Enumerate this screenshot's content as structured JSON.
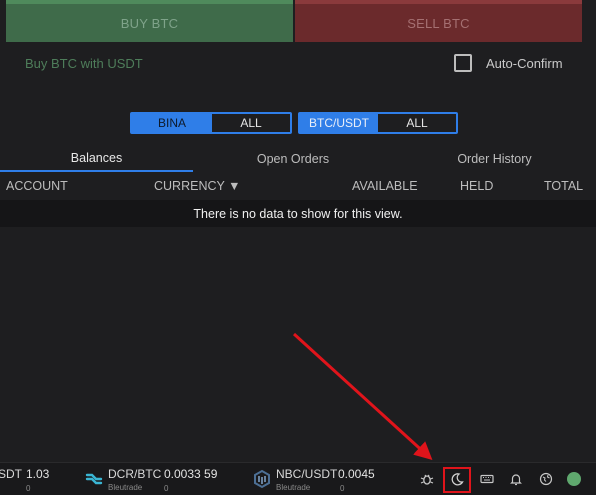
{
  "trade": {
    "buy_label": "BUY BTC",
    "sell_label": "SELL BTC",
    "buy_with": "Buy BTC with USDT",
    "auto_confirm": "Auto-Confirm"
  },
  "filters": {
    "exchange": [
      "BINA",
      "ALL"
    ],
    "market": [
      "BTC/USDT",
      "ALL"
    ]
  },
  "tabs": [
    "Balances",
    "Open Orders",
    "Order History"
  ],
  "table": {
    "columns": [
      "ACCOUNT",
      "CURRENCY ▼",
      "AVAILABLE",
      "HELD",
      "TOTAL"
    ],
    "empty_message": "There is no data to show for this view."
  },
  "tickers": [
    {
      "pair": "SDT",
      "price": "1.03",
      "exchange": "",
      "change": "0"
    },
    {
      "pair": "DCR/BTC",
      "price": "0.0033 59",
      "exchange": "Bleutrade",
      "change": "0"
    },
    {
      "pair": "NBC/USDT",
      "price": "0.0045",
      "exchange": "Bleutrade",
      "change": "0"
    }
  ],
  "colors": {
    "accent": "#2f7ee8",
    "buy": "#3f6b4a",
    "sell": "#6b2a2c",
    "annotation": "#e0141b",
    "online": "#5fa86e"
  },
  "icons": [
    "bug-icon",
    "moon-icon",
    "keyboard-icon",
    "bell-icon",
    "globe-icon",
    "status-dot"
  ]
}
